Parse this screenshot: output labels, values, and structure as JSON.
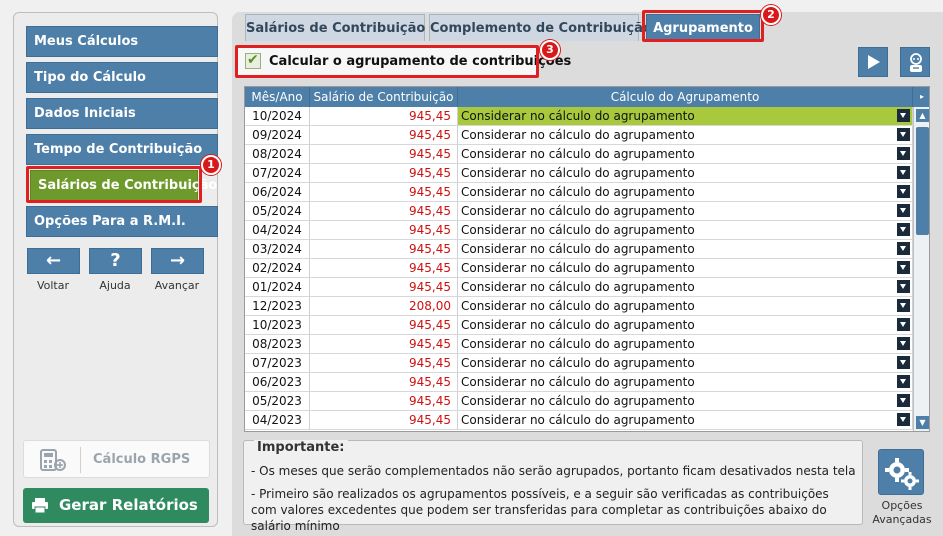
{
  "sidebar": {
    "items": [
      {
        "label": "Meus Cálculos"
      },
      {
        "label": "Tipo do Cálculo"
      },
      {
        "label": "Dados Iniciais"
      },
      {
        "label": "Tempo de Contribuição"
      },
      {
        "label": "Salários de Contribuição",
        "active": true
      },
      {
        "label": "Opções Para a R.M.I."
      }
    ],
    "nav": {
      "back_icon": "←",
      "back_label": "Voltar",
      "help_icon": "?",
      "help_label": "Ajuda",
      "next_icon": "→",
      "next_label": "Avançar"
    },
    "rgps_label": "Cálculo RGPS",
    "report_label": "Gerar Relatórios"
  },
  "tabs": [
    {
      "label": "Salários de Contribuição"
    },
    {
      "label": "Complemento de Contribuição"
    },
    {
      "label": "Agrupamento",
      "active": true
    }
  ],
  "checkbox": {
    "label": "Calcular o agrupamento de contribuições",
    "checked": true,
    "check_mark": "✔"
  },
  "callouts": {
    "one": "1",
    "two": "2",
    "three": "3"
  },
  "table": {
    "columns": [
      "Mês/Ano",
      "Salário de Contribuição",
      "Cálculo do Agrupamento"
    ],
    "rows": [
      {
        "month": "10/2024",
        "salary": "945,45",
        "calc": "Considerar no cálculo do agrupamento",
        "selected": true
      },
      {
        "month": "09/2024",
        "salary": "945,45",
        "calc": "Considerar no cálculo do agrupamento"
      },
      {
        "month": "08/2024",
        "salary": "945,45",
        "calc": "Considerar no cálculo do agrupamento"
      },
      {
        "month": "07/2024",
        "salary": "945,45",
        "calc": "Considerar no cálculo do agrupamento"
      },
      {
        "month": "06/2024",
        "salary": "945,45",
        "calc": "Considerar no cálculo do agrupamento"
      },
      {
        "month": "05/2024",
        "salary": "945,45",
        "calc": "Considerar no cálculo do agrupamento"
      },
      {
        "month": "04/2024",
        "salary": "945,45",
        "calc": "Considerar no cálculo do agrupamento"
      },
      {
        "month": "03/2024",
        "salary": "945,45",
        "calc": "Considerar no cálculo do agrupamento"
      },
      {
        "month": "02/2024",
        "salary": "945,45",
        "calc": "Considerar no cálculo do agrupamento"
      },
      {
        "month": "01/2024",
        "salary": "945,45",
        "calc": "Considerar no cálculo do agrupamento"
      },
      {
        "month": "12/2023",
        "salary": "208,00",
        "calc": "Considerar no cálculo do agrupamento"
      },
      {
        "month": "10/2023",
        "salary": "945,45",
        "calc": "Considerar no cálculo do agrupamento"
      },
      {
        "month": "08/2023",
        "salary": "945,45",
        "calc": "Considerar no cálculo do agrupamento"
      },
      {
        "month": "07/2023",
        "salary": "945,45",
        "calc": "Considerar no cálculo do agrupamento"
      },
      {
        "month": "06/2023",
        "salary": "945,45",
        "calc": "Considerar no cálculo do agrupamento"
      },
      {
        "month": "05/2023",
        "salary": "945,45",
        "calc": "Considerar no cálculo do agrupamento"
      },
      {
        "month": "04/2023",
        "salary": "945,45",
        "calc": "Considerar no cálculo do agrupamento"
      }
    ]
  },
  "info": {
    "title": "Importante:",
    "lines": [
      "- Os meses que serão complementados não serão agrupados, portanto ficam desativados nesta tela",
      "- Primeiro são realizados os agrupamentos possíveis, e a seguir são verificadas as contribuições com valores excedentes que podem ser transferidas para completar as contribuições abaixo do salário mínimo"
    ]
  },
  "advanced": {
    "label": "Opções Avançadas"
  },
  "colors": {
    "accent": "#4d7fa8",
    "active": "#6e9a2b",
    "highlight": "#e02020",
    "salary": "#d01010",
    "report": "#2f8a60"
  }
}
